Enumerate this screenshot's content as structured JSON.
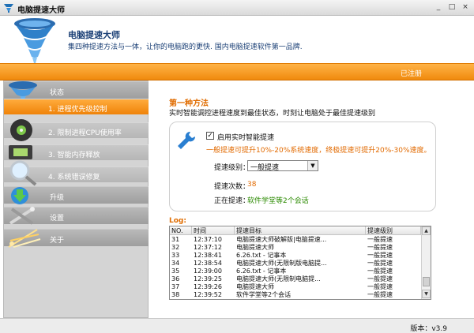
{
  "window": {
    "title": "电脑提速大师",
    "min_label": "_",
    "max_label": "□",
    "close_label": "×"
  },
  "header": {
    "app_name": "电脑提速大师",
    "slogan": "集四种提速方法与一体，让你的电脑跑的更快. 国内电脑提速软件第一品牌."
  },
  "orange_bar": {
    "status": "已注册"
  },
  "sidebar": {
    "items": [
      {
        "label": "状态",
        "kind": "cat",
        "icon": "tornado-icon"
      },
      {
        "label": "1. 进程优先级控制",
        "kind": "sub",
        "active": true
      },
      {
        "label": "2. 限制进程CPU使用率",
        "kind": "sub"
      },
      {
        "label": "3. 智能内存释放",
        "kind": "sub"
      },
      {
        "label": "4. 系统错误修复",
        "kind": "sub"
      },
      {
        "label": "升级",
        "kind": "cat",
        "icon": "download-arrow-icon"
      },
      {
        "label": "设置",
        "kind": "cat",
        "icon": "tools-icon"
      },
      {
        "label": "关于",
        "kind": "cat",
        "icon": "sparkle-icon"
      }
    ]
  },
  "main": {
    "method_title": "第一种方法",
    "method_desc": "实时智能调控进程速度到最佳状态，时刻让电脑处于最佳提速级别",
    "smart": {
      "check_mark": "✓",
      "label": "启用实时智能提速",
      "note": "一般提速可提升10%-20%系统速度，终极提速可提升20%-30%速度。"
    },
    "level": {
      "label": "提速级别：",
      "value": "一般提速",
      "arrow": "▼"
    },
    "count": {
      "label": "提速次数：",
      "value": "38"
    },
    "running": {
      "label": "正在提速：",
      "value": "软件学堂等2个会话"
    },
    "log": {
      "label": "Log:",
      "columns": [
        "NO.",
        "时间",
        "提速目标",
        "提速级别"
      ],
      "rows": [
        [
          "31",
          "12:37:10",
          "电脑提速大师破解版|电脑提速...",
          "一般提速"
        ],
        [
          "32",
          "12:37:12",
          "电脑提速大师",
          "一般提速"
        ],
        [
          "33",
          "12:38:41",
          "6.26.txt - 记事本",
          "一般提速"
        ],
        [
          "34",
          "12:38:54",
          "电脑提速大师(无限制版电脑提...",
          "一般提速"
        ],
        [
          "35",
          "12:39:00",
          "6.26.txt - 记事本",
          "一般提速"
        ],
        [
          "36",
          "12:39:25",
          "电脑提速大师(无限制电脑提...",
          "一般提速"
        ],
        [
          "37",
          "12:39:26",
          "电脑提速大师",
          "一般提速"
        ],
        [
          "38",
          "12:39:52",
          "软件学堂等2个会话",
          "一般提速"
        ]
      ]
    }
  },
  "status_bar": {
    "version": "版本：v3.9"
  },
  "colors": {
    "accent": "#f08a0d",
    "title_orange": "#e06c00",
    "note_orange": "#e26a00",
    "running_green": "#2b8a00",
    "brand_blue": "#1a3f75"
  }
}
